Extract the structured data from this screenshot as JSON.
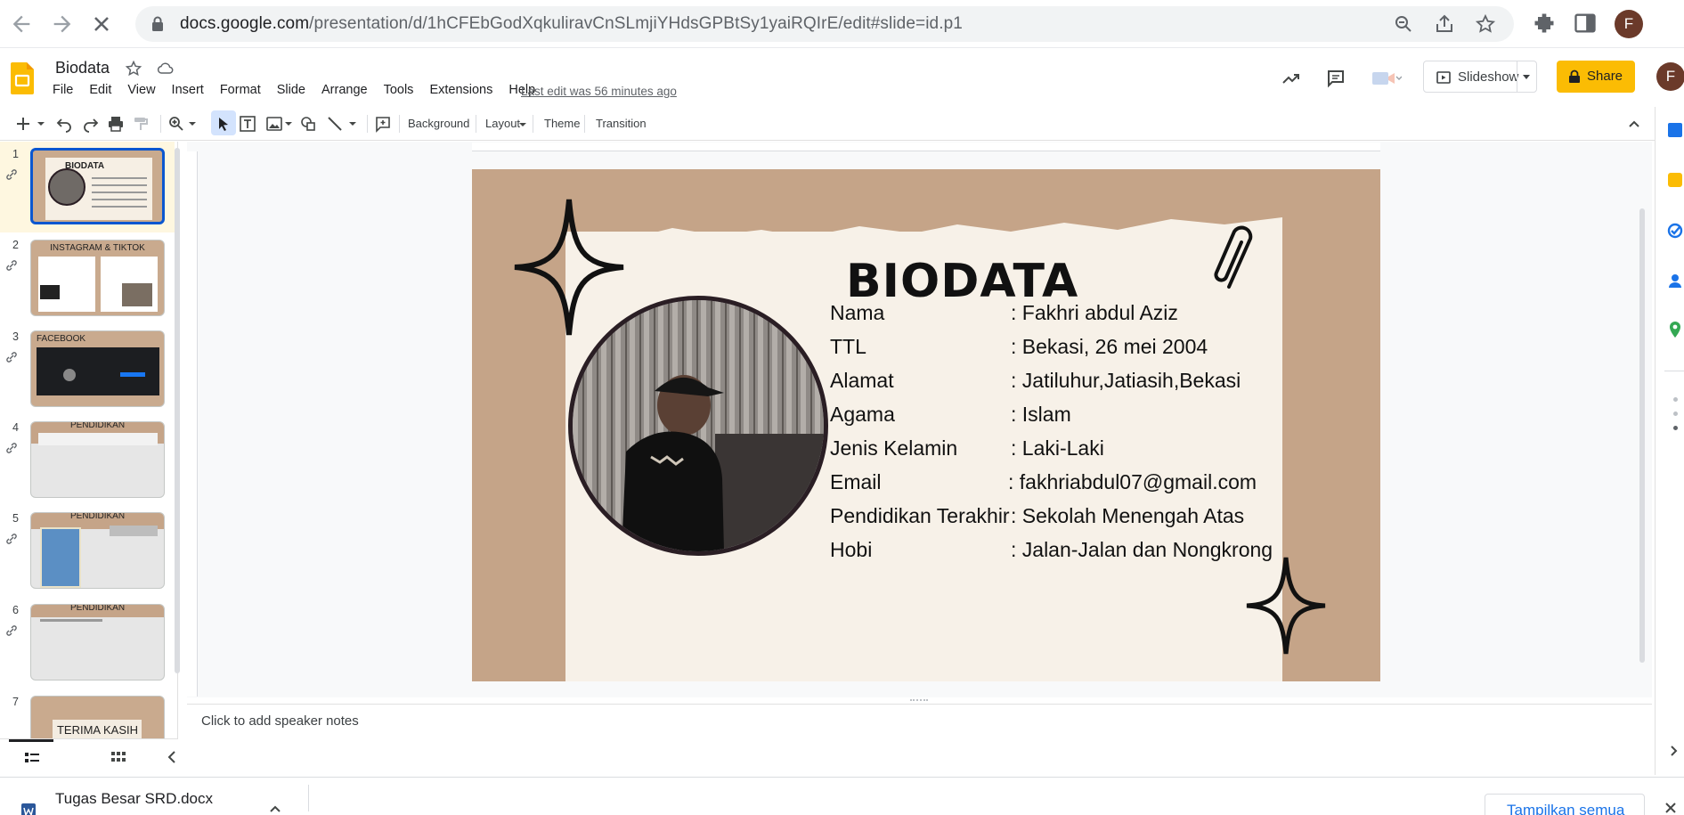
{
  "browser": {
    "url_host": "docs.google.com",
    "url_path": "/presentation/d/1hCFEbGodXqkuliravCnSLmjiYHdsGPBtSy1yaiRQIrE/edit#slide=id.p1",
    "profile_initial": "F"
  },
  "doc": {
    "title": "Biodata",
    "last_edit": "Last edit was 56 minutes ago",
    "menus": [
      "File",
      "Edit",
      "View",
      "Insert",
      "Format",
      "Slide",
      "Arrange",
      "Tools",
      "Extensions",
      "Help"
    ],
    "slideshow_label": "Slideshow",
    "share_label": "Share",
    "account_initial": "F"
  },
  "toolbar": {
    "background": "Background",
    "layout": "Layout",
    "theme": "Theme",
    "transition": "Transition"
  },
  "filmstrip": {
    "slides": [
      {
        "num": "1",
        "caption": "BIODATA"
      },
      {
        "num": "2",
        "caption": "INSTAGRAM & TIKTOK"
      },
      {
        "num": "3",
        "caption": "FACEBOOK"
      },
      {
        "num": "4",
        "caption": "PENDIDIKAN"
      },
      {
        "num": "5",
        "caption": "PENDIDIKAN"
      },
      {
        "num": "6",
        "caption": "PENDIDIKAN"
      },
      {
        "num": "7",
        "caption": "TERIMA KASIH"
      }
    ]
  },
  "slide": {
    "title": "BIODATA",
    "rows": [
      {
        "label": "Nama",
        "value": ": Fakhri abdul Aziz"
      },
      {
        "label": "TTL",
        "value": ": Bekasi, 26 mei 2004"
      },
      {
        "label": "Alamat",
        "value": ": Jatiluhur,Jatiasih,Bekasi"
      },
      {
        "label": "Agama",
        "value": ": Islam"
      },
      {
        "label": "Jenis Kelamin",
        "value": ": Laki-Laki"
      },
      {
        "label": "Email",
        "value": ": fakhriabdul07@gmail.com"
      },
      {
        "label": "Pendidikan Terakhir",
        "value": ": Sekolah Menengah Atas"
      },
      {
        "label": "Hobi",
        "value": ": Jalan-Jalan dan Nongkrong"
      }
    ]
  },
  "notes": {
    "placeholder": "Click to add speaker notes"
  },
  "downloads": {
    "file_name": "Tugas Besar SRD.docx",
    "show_all": "Tampilkan semua"
  },
  "colors": {
    "accent": "#fbbc04",
    "selection": "#0b57d0",
    "slide_bg": "#c5a488",
    "paper": "#f7f1e8"
  }
}
